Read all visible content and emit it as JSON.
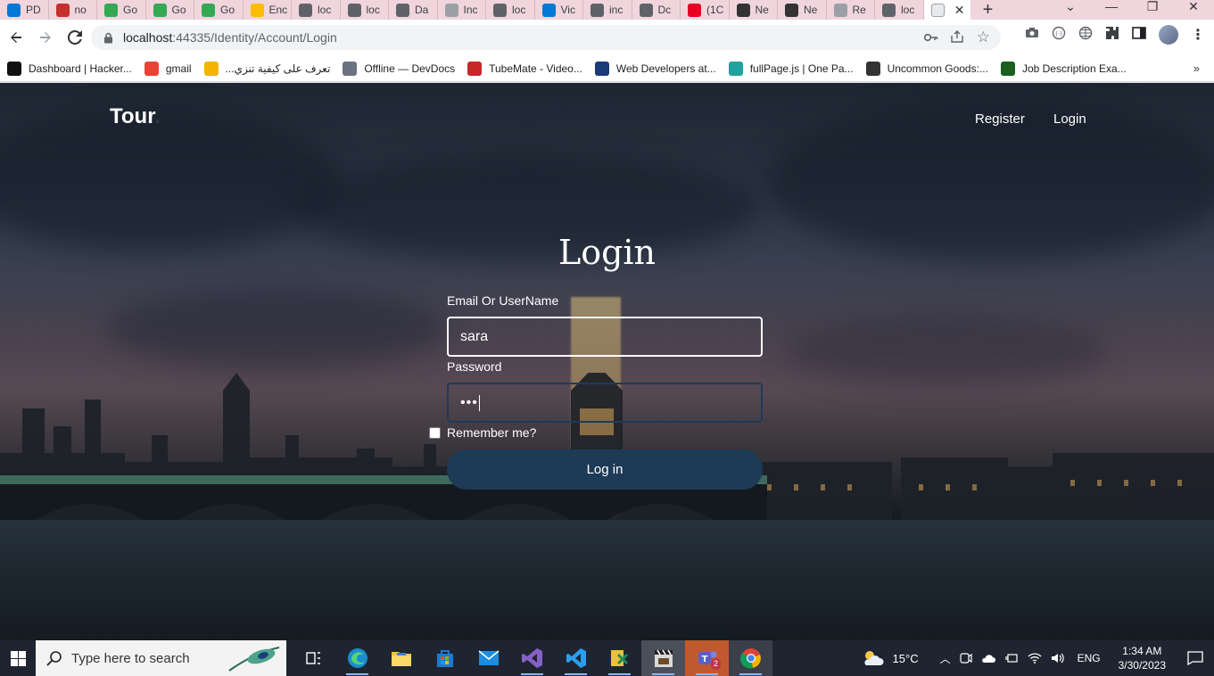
{
  "browser": {
    "tabs": [
      {
        "label": "PD",
        "icon": "cloud-icon",
        "color": "#0078d4"
      },
      {
        "label": "no",
        "icon": "notion-icon",
        "color": "#c4302b"
      },
      {
        "label": "Go",
        "icon": "google-meet-icon",
        "color": "#34a853"
      },
      {
        "label": "Go",
        "icon": "google-meet-icon",
        "color": "#34a853"
      },
      {
        "label": "Go",
        "icon": "google-meet-icon",
        "color": "#34a853"
      },
      {
        "label": "Enc",
        "icon": "google-drive-icon",
        "color": "#fbbc04"
      },
      {
        "label": "loc",
        "icon": "globe-icon",
        "color": "#5f6368"
      },
      {
        "label": "loc",
        "icon": "globe-icon",
        "color": "#5f6368"
      },
      {
        "label": "Da",
        "icon": "diamond-icon",
        "color": "#5f6368"
      },
      {
        "label": "Inc",
        "icon": "document-icon",
        "color": "#9aa0a6"
      },
      {
        "label": "loc",
        "icon": "globe-icon",
        "color": "#5f6368"
      },
      {
        "label": "Vic",
        "icon": "cloud-icon",
        "color": "#0078d4"
      },
      {
        "label": "inc",
        "icon": "globe-icon",
        "color": "#5f6368"
      },
      {
        "label": "Dc",
        "icon": "globe-icon",
        "color": "#5f6368"
      },
      {
        "label": "(1C",
        "icon": "pinterest-icon",
        "color": "#e60023"
      },
      {
        "label": "Ne",
        "icon": "github-icon",
        "color": "#333333"
      },
      {
        "label": "Ne",
        "icon": "github-icon",
        "color": "#333333"
      },
      {
        "label": "Re",
        "icon": "document-icon",
        "color": "#9aa0a6"
      },
      {
        "label": "loc",
        "icon": "globe-icon",
        "color": "#5f6368"
      }
    ],
    "active_tab": {
      "label": "",
      "icon": "document-icon"
    },
    "new_tab": "+",
    "url_host": "localhost",
    "url_rest": ":44335/Identity/Account/Login",
    "bookmarks": [
      {
        "label": "Dashboard | Hacker...",
        "icon": "hackerrank-icon",
        "color": "#111111"
      },
      {
        "label": "gmail",
        "icon": "gmail-icon",
        "color": "#ea4335"
      },
      {
        "label": "...تعرف على كيفية تنزي",
        "icon": "download-icon",
        "color": "#f4b400"
      },
      {
        "label": "Offline — DevDocs",
        "icon": "devdocs-icon",
        "color": "#6b7280"
      },
      {
        "label": "TubeMate - Video...",
        "icon": "tubemate-icon",
        "color": "#c62828"
      },
      {
        "label": "Web Developers at...",
        "icon": "globe-icon",
        "color": "#1a3a7a"
      },
      {
        "label": "fullPage.js | One Pa...",
        "icon": "fullpage-icon",
        "color": "#20a39e"
      },
      {
        "label": "Uncommon Goods:...",
        "icon": "uncommon-goods-icon",
        "color": "#333333"
      },
      {
        "label": "Job Description Exa...",
        "icon": "job-icon",
        "color": "#1b5e20"
      }
    ],
    "more_bookmarks": "»"
  },
  "site": {
    "brand": "Tour",
    "brand_dot": ".",
    "nav": {
      "register": "Register",
      "login": "Login"
    },
    "form": {
      "title": "Login",
      "email_label": "Email Or UserName",
      "email_value": "sara",
      "password_label": "Password",
      "password_value": "•••",
      "remember_label": "Remember me?",
      "submit_label": "Log in"
    }
  },
  "taskbar": {
    "search_placeholder": "Type here to search",
    "weather": "15°C",
    "language": "ENG",
    "time": "1:34 AM",
    "date": "3/30/2023",
    "teams_badge": "2"
  },
  "colors": {
    "button": "#1d3a56",
    "tabstrip": "#f0d5dc",
    "taskbar": "#1f2530"
  }
}
